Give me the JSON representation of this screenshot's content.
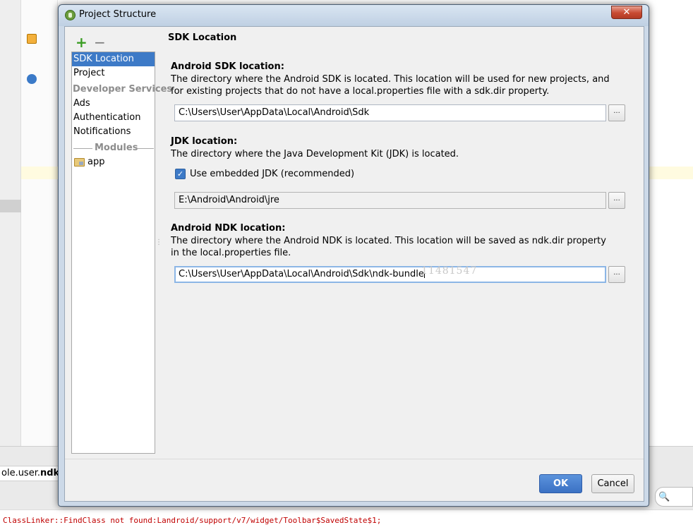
{
  "background": {
    "tab_prefix": "ole.user.",
    "tab_bold": "ndkte",
    "log_line": "ClassLinker::FindClass not found:Landroid/support/v7/widget/Toolbar$SavedState$1;",
    "search_icon": "🔍"
  },
  "dialog": {
    "title": "Project Structure",
    "close_label": "✕",
    "toolbar": {
      "add_label": "+",
      "remove_label": "−"
    },
    "sidebar": {
      "sdk_location": "SDK Location",
      "project": "Project",
      "developer_services": "Developer Services",
      "ads": "Ads",
      "authentication": "Authentication",
      "notifications": "Notifications",
      "modules": "Modules",
      "app": "app"
    },
    "panel": {
      "title": "SDK Location",
      "sdk": {
        "title": "Android SDK location:",
        "desc": "The directory where the Android SDK is located. This location will be used for new projects, and for existing projects that do not have a local.properties file with a sdk.dir property.",
        "path": "C:\\Users\\User\\AppData\\Local\\Android\\Sdk"
      },
      "jdk": {
        "title": "JDK location:",
        "desc": "The directory where the Java Development Kit (JDK) is located.",
        "checkbox_label": "Use embedded JDK (recommended)",
        "checkbox_checked": true,
        "path": "E:\\Android\\Android\\jre"
      },
      "ndk": {
        "title": "Android NDK location:",
        "desc": "The directory where the Android NDK is located. This location will be saved as ndk.dir property in the local.properties file.",
        "path": "C:\\Users\\User\\AppData\\Local\\Android\\Sdk\\ndk-bundle",
        "watermark": "11481547"
      },
      "browse_label": "..."
    },
    "buttons": {
      "ok": "OK",
      "cancel": "Cancel"
    }
  }
}
